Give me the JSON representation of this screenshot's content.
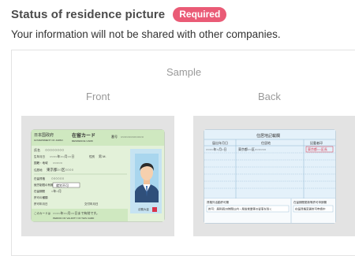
{
  "header": {
    "title": "Status of residence picture",
    "required_badge": "Required",
    "subtitle": "Your information will not be shared with other companies."
  },
  "sample": {
    "heading": "Sample",
    "front_label": "Front",
    "back_label": "Back"
  },
  "front_card": {
    "country_jp": "日本国政府",
    "country_en": "GOVERNMENT OF JAPAN",
    "card_title_jp": "在留カード",
    "card_title_en": "RESIDENCE CARD",
    "number_label": "番号",
    "number_value": "○○○○○○○○○○○○",
    "name_label": "氏名",
    "name_value": "○○○○○○○○",
    "dob_label": "生年月日",
    "dob_value": "○○○○年○○月○○日",
    "sex_label": "性別",
    "sex_value": "男 M.",
    "nationality_label": "国籍・地域",
    "nationality_value": "○○○○○",
    "address_label": "住居地",
    "address_value": "東京都○○区○○○○",
    "status_label": "在留資格",
    "status_value": "○○○○○○",
    "permission_label": "就労制限の有無",
    "permission_value": "就労不可",
    "period_label": "在留期間",
    "period_value": "○年○月",
    "permit_label": "許可の種類",
    "permit_date_label": "許可年月日",
    "issue_date_label": "交付年月日",
    "expiry_label": "このカードは",
    "expiry_value": "○○○○年○○月○○日まで有効です。",
    "expiry_en": "PERIOD OF VALIDITY OF THIS CARD",
    "photo_caption": "法務大臣"
  },
  "back_card": {
    "section_title": "住居地記載欄",
    "col_date": "届出年月日",
    "col_address": "住居地",
    "col_stamp": "記載者印",
    "row1_date": "○○○○年○月○日",
    "row1_address": "東京都○○区○○○○○○",
    "row1_stamp": "東京都○○区長",
    "footer_left_title": "資格外活動許可欄",
    "footer_left_text": "許可：原則週28時間以内・風俗営業等の従事を除く",
    "footer_right_title": "在留期間更新等許可申請欄",
    "footer_right_text": "在留資格変更許可申請中"
  },
  "colors": {
    "badge": "#ea5b76",
    "card_green": "#cfe8c0",
    "card_blue": "#c6e3f2",
    "back_blue": "#e4f1fa",
    "stamp_red": "#d8334a"
  }
}
